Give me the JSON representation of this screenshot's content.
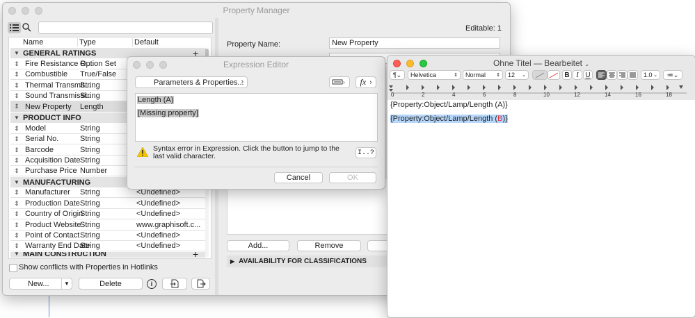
{
  "property_manager": {
    "title": "Property Manager",
    "search_placeholder": "",
    "columns": [
      "Name",
      "Type",
      "Default"
    ],
    "groups": [
      {
        "name": "GENERAL RATINGS",
        "items": [
          {
            "name": "Fire Resistance R...",
            "type": "Option Set",
            "default": ""
          },
          {
            "name": "Combustible",
            "type": "True/False",
            "default": ""
          },
          {
            "name": "Thermal Transmit...",
            "type": "String",
            "default": ""
          },
          {
            "name": "Sound Transmissi...",
            "type": "String",
            "default": ""
          },
          {
            "name": "New Property",
            "type": "Length",
            "default": ""
          }
        ]
      },
      {
        "name": "PRODUCT INFO",
        "items": [
          {
            "name": "Model",
            "type": "String",
            "default": ""
          },
          {
            "name": "Serial No.",
            "type": "String",
            "default": ""
          },
          {
            "name": "Barcode",
            "type": "String",
            "default": ""
          },
          {
            "name": "Acquisition Date",
            "type": "String",
            "default": ""
          },
          {
            "name": "Purchase Price",
            "type": "Number",
            "default": ""
          }
        ]
      },
      {
        "name": "MANUFACTURING",
        "items": [
          {
            "name": "Manufacturer",
            "type": "String",
            "default": "<Undefined>"
          },
          {
            "name": "Production Date",
            "type": "String",
            "default": "<Undefined>"
          },
          {
            "name": "Country of Origin",
            "type": "String",
            "default": "<Undefined>"
          },
          {
            "name": "Product Website",
            "type": "String",
            "default": "www.graphisoft.c..."
          },
          {
            "name": "Point of Contact",
            "type": "String",
            "default": "<Undefined>"
          },
          {
            "name": "Warranty End Date",
            "type": "String",
            "default": "<Undefined>"
          }
        ]
      },
      {
        "name": "MAIN CONSTRUCTION",
        "items": []
      }
    ],
    "show_conflicts_label": "Show conflicts with Properties in Hotlinks",
    "new_button": "New...",
    "delete_button": "Delete",
    "editable_label": "Editable: 1",
    "property_name_label": "Property Name:",
    "property_name_value": "New Property",
    "add_button": "Add...",
    "remove_button": "Remove",
    "availability_label": "AVAILABILITY FOR CLASSIFICATIONS"
  },
  "expression_editor": {
    "title": "Expression Editor",
    "params_button": "Parameters & Properties...",
    "fx_label": "fx",
    "expr_line1": "Length (A)",
    "expr_line2": "[Missing property]",
    "error_text": "Syntax error in Expression. Click the button to jump to the last valid character.",
    "jump_button": "I..?",
    "cancel_button": "Cancel",
    "ok_button": "OK"
  },
  "textedit": {
    "title": "Ohne Titel — Bearbeitet",
    "font": "Helvetica",
    "style": "Normal",
    "size": "12",
    "spacing": "1.0",
    "ruler_numbers": [
      "0",
      "2",
      "4",
      "6",
      "8",
      "10",
      "12",
      "14",
      "16",
      "18"
    ],
    "line1": "{Property:Object/Lamp/Length (A)}",
    "line2_prefix": "{Property:Object/Lamp/Length (",
    "line2_letter": "B",
    "line2_suffix": ")}"
  }
}
